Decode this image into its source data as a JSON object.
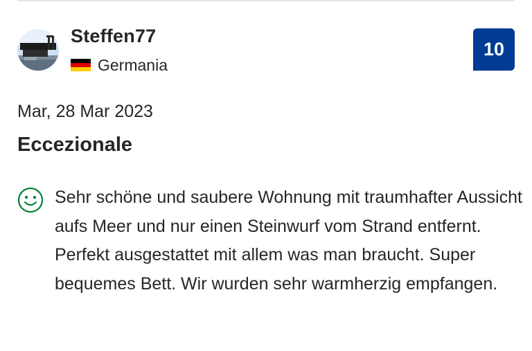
{
  "reviewer": {
    "name": "Steffen77",
    "country": "Germania",
    "flag_colors": [
      "#000000",
      "#dd0000",
      "#ffce00"
    ]
  },
  "score": "10",
  "review": {
    "date": "Mar, 28 Mar 2023",
    "title": "Eccezionale",
    "positive_icon": "smile-icon",
    "positive_text": "Sehr schöne und saubere Wohnung mit traumhafter Aussicht aufs Meer und nur einen Steinwurf vom Strand entfernt. Perfekt ausgestattet mit allem was man braucht. Super bequemes Bett. Wir wurden sehr warmherzig empfangen."
  },
  "colors": {
    "badge": "#003b95",
    "positive": "#008234"
  }
}
